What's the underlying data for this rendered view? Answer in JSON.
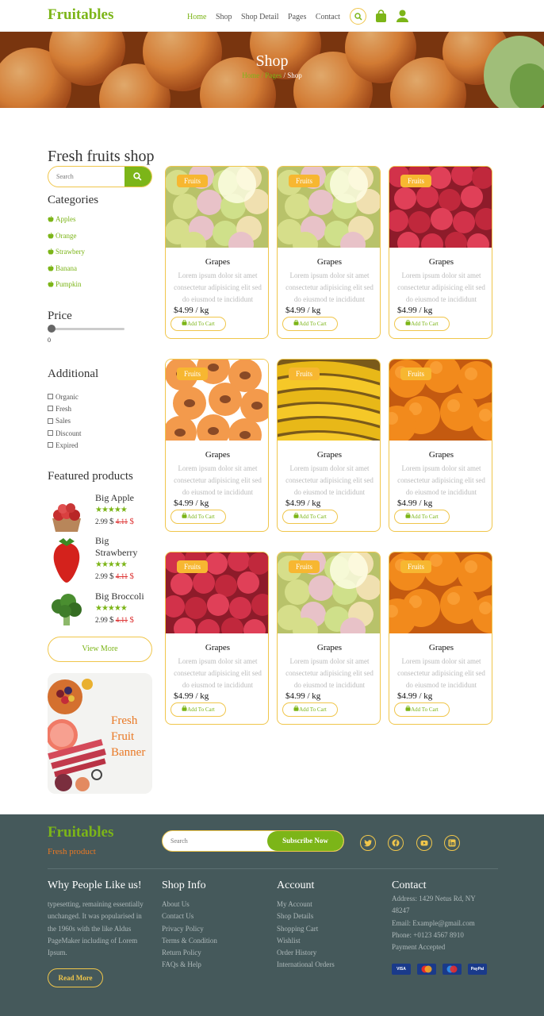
{
  "brand": "Fruitables",
  "nav": {
    "items": [
      "Home",
      "Shop",
      "Shop Detail",
      "Pages",
      "Contact"
    ]
  },
  "hero": {
    "title": "Shop",
    "breadcrumb": [
      "Home",
      "Pages",
      "Shop"
    ]
  },
  "sidebar": {
    "title": "Fresh fruits shop",
    "search_placeholder": "Search",
    "categories_title": "Categories",
    "categories": [
      "Apples",
      "Orange",
      "Strawbery",
      "Banana",
      "Pumpkin"
    ],
    "price_title": "Price",
    "price_value": "0",
    "additional_title": "Additional",
    "additional": [
      "Organic",
      "Fresh",
      "Sales",
      "Discount",
      "Expired"
    ],
    "featured_title": "Featured products",
    "featured": [
      {
        "name": "Big Apple",
        "stars": 5,
        "price": "2.99",
        "currency": "$",
        "old_price": "4.11"
      },
      {
        "name": "Big Strawberry",
        "stars": 5,
        "price": "2.99",
        "currency": "$",
        "old_price": "4.11"
      },
      {
        "name": "Big Broccoli",
        "stars": 5,
        "price": "2.99",
        "currency": "$",
        "old_price": "4.11"
      }
    ],
    "view_more": "View More",
    "banner": [
      "Fresh",
      "Fruit",
      "Banner"
    ]
  },
  "products": [
    {
      "tag": "Fruits",
      "name": "Grapes",
      "desc": "Lorem ipsum dolor sit amet consectetur adipisicing elit sed do eiusmod te incididunt",
      "price": "$4.99 / kg",
      "button": "Add To Cart",
      "image": "grapes"
    },
    {
      "tag": "Fruits",
      "name": "Grapes",
      "desc": "Lorem ipsum dolor sit amet consectetur adipisicing elit sed do eiusmod te incididunt",
      "price": "$4.99 / kg",
      "button": "Add To Cart",
      "image": "grapes"
    },
    {
      "tag": "Fruits",
      "name": "Grapes",
      "desc": "Lorem ipsum dolor sit amet consectetur adipisicing elit sed do eiusmod te incididunt",
      "price": "$4.99 / kg",
      "button": "Add To Cart",
      "image": "raspberries"
    },
    {
      "tag": "Fruits",
      "name": "Grapes",
      "desc": "Lorem ipsum dolor sit amet consectetur adipisicing elit sed do eiusmod te incididunt",
      "price": "$4.99 / kg",
      "button": "Add To Cart",
      "image": "apricots"
    },
    {
      "tag": "Fruits",
      "name": "Grapes",
      "desc": "Lorem ipsum dolor sit amet consectetur adipisicing elit sed do eiusmod te incididunt",
      "price": "$4.99 / kg",
      "button": "Add To Cart",
      "image": "bananas"
    },
    {
      "tag": "Fruits",
      "name": "Grapes",
      "desc": "Lorem ipsum dolor sit amet consectetur adipisicing elit sed do eiusmod te incididunt",
      "price": "$4.99 / kg",
      "button": "Add To Cart",
      "image": "oranges"
    },
    {
      "tag": "Fruits",
      "name": "Grapes",
      "desc": "Lorem ipsum dolor sit amet consectetur adipisicing elit sed do eiusmod te incididunt",
      "price": "$4.99 / kg",
      "button": "Add To Cart",
      "image": "raspberries"
    },
    {
      "tag": "Fruits",
      "name": "Grapes",
      "desc": "Lorem ipsum dolor sit amet consectetur adipisicing elit sed do eiusmod te incididunt",
      "price": "$4.99 / kg",
      "button": "Add To Cart",
      "image": "grapes"
    },
    {
      "tag": "Fruits",
      "name": "Grapes",
      "desc": "Lorem ipsum dolor sit amet consectetur adipisicing elit sed do eiusmod te incididunt",
      "price": "$4.99 / kg",
      "button": "Add To Cart",
      "image": "oranges"
    }
  ],
  "footer": {
    "tagline": "Fresh product",
    "search_placeholder": "Search",
    "subscribe": "Subscribe Now",
    "social_icons": [
      "twitter-icon",
      "facebook-icon",
      "youtube-icon",
      "linkedin-icon"
    ],
    "why_title": "Why People Like us!",
    "why_text": "typesetting, remaining essentially unchanged. It was popularised in the 1960s with the like Aldus PageMaker including of Lorem Ipsum.",
    "read_more": "Read More",
    "shop_title": "Shop Info",
    "shop_links": [
      "About Us",
      "Contact Us",
      "Privacy Policy",
      "Terms & Condition",
      "Return Policy",
      "FAQs & Help"
    ],
    "account_title": "Account",
    "account_links": [
      "My Account",
      "Shop Details",
      "Shopping Cart",
      "Wishlist",
      "Order History",
      "International Orders"
    ],
    "contact_title": "Contact",
    "contact_lines": [
      "Address: 1429 Netus Rd, NY 48247",
      "Email: Example@gmail.com",
      "Phone: +0123 4567 8910",
      "Payment Accepted"
    ],
    "payments": [
      "VISA",
      "MC",
      "Maestro",
      "PayPal"
    ]
  },
  "colors": {
    "accent": "#7cb518",
    "secondary": "#f0c64b",
    "tag": "#f7b731",
    "footer": "#45595b",
    "orange": "#e97824"
  }
}
